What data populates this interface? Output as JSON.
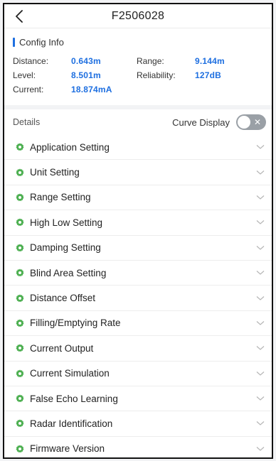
{
  "header": {
    "title": "F2506028",
    "back_icon": "chevron-left-icon"
  },
  "config": {
    "title": "Config Info",
    "accent": "#1e6fe0",
    "fields": [
      {
        "label": "Distance:",
        "value": "0.643m"
      },
      {
        "label": "Range:",
        "value": "9.144m"
      },
      {
        "label": "Level:",
        "value": "8.501m"
      },
      {
        "label": "Reliability:",
        "value": "127dB"
      },
      {
        "label": "Current:",
        "value": "18.874mA"
      }
    ]
  },
  "details": {
    "label": "Details",
    "curve_display_label": "Curve Display",
    "curve_display_on": false
  },
  "menu": {
    "icon_color": "#4caf50",
    "items": [
      {
        "label": "Application Setting"
      },
      {
        "label": "Unit Setting"
      },
      {
        "label": "Range Setting"
      },
      {
        "label": "High Low Setting"
      },
      {
        "label": "Damping Setting"
      },
      {
        "label": "Blind Area Setting"
      },
      {
        "label": "Distance Offset"
      },
      {
        "label": "Filling/Emptying Rate"
      },
      {
        "label": "Current Output"
      },
      {
        "label": "Current Simulation"
      },
      {
        "label": "False Echo Learning"
      },
      {
        "label": "Radar Identification"
      },
      {
        "label": "Firmware Version"
      }
    ]
  }
}
